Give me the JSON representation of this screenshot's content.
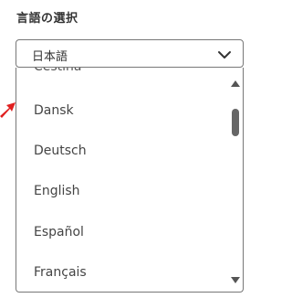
{
  "heading": "言語の選択",
  "select": {
    "value": "日本語",
    "icon": "chevron-down-icon"
  },
  "options": [
    {
      "label": "Čeština",
      "state": "partially-scrolled-out"
    },
    {
      "label": "Dansk"
    },
    {
      "label": "Deutsch"
    },
    {
      "label": "English"
    },
    {
      "label": "Español"
    },
    {
      "label": "Français"
    }
  ],
  "scrollbar": {
    "up_icon": "triangle-up-icon",
    "down_icon": "triangle-down-icon",
    "position_fraction": 0.1
  },
  "annotation": {
    "icon": "red-arrow-icon",
    "color": "#e02020"
  },
  "colors": {
    "border": "#777777",
    "text": "#333333",
    "scroll_thumb": "#666666"
  }
}
